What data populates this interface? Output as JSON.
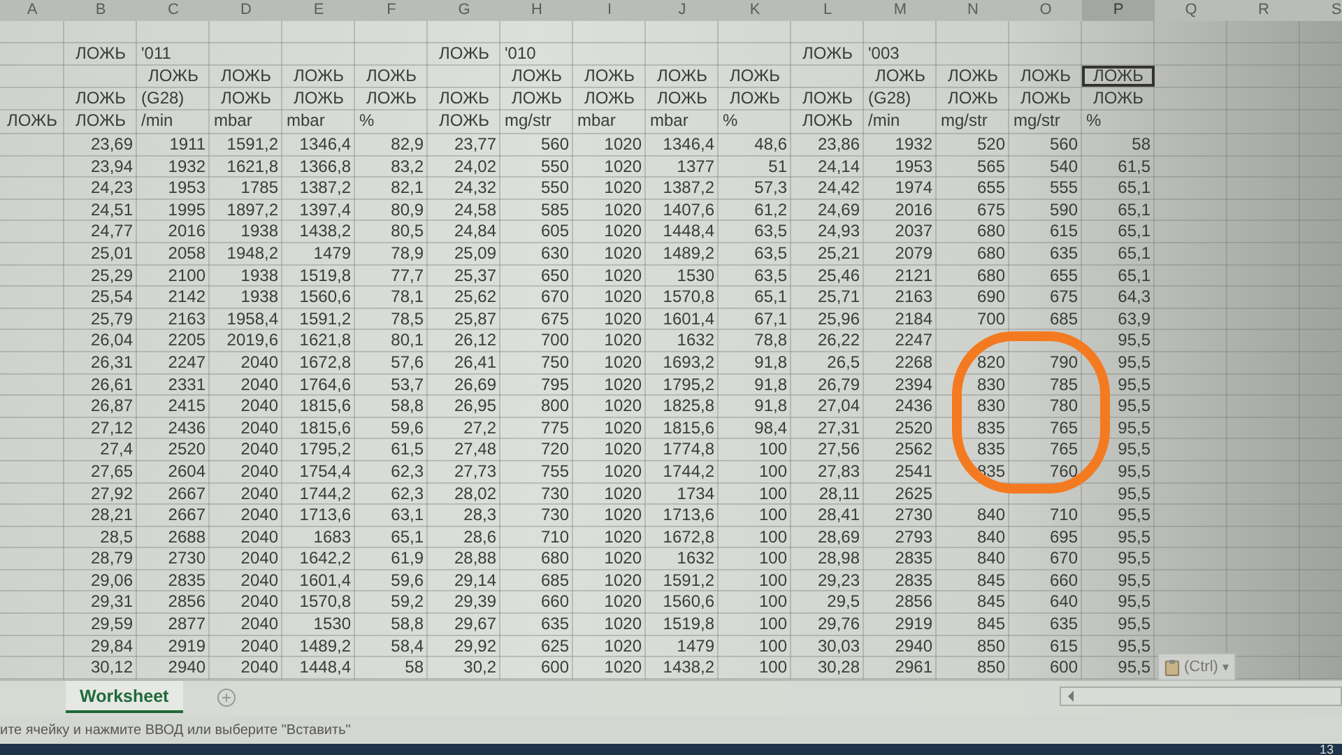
{
  "columns": [
    {
      "label": "A",
      "selected": false
    },
    {
      "label": "B",
      "selected": false
    },
    {
      "label": "C",
      "selected": false
    },
    {
      "label": "D",
      "selected": false
    },
    {
      "label": "E",
      "selected": false
    },
    {
      "label": "F",
      "selected": false
    },
    {
      "label": "G",
      "selected": false
    },
    {
      "label": "H",
      "selected": false
    },
    {
      "label": "I",
      "selected": false
    },
    {
      "label": "J",
      "selected": false
    },
    {
      "label": "K",
      "selected": false
    },
    {
      "label": "L",
      "selected": false
    },
    {
      "label": "M",
      "selected": false
    },
    {
      "label": "N",
      "selected": false
    },
    {
      "label": "O",
      "selected": false
    },
    {
      "label": "P",
      "selected": true
    },
    {
      "label": "Q",
      "selected": false
    },
    {
      "label": "R",
      "selected": false
    },
    {
      "label": "S",
      "selected": false
    }
  ],
  "rows": [
    {
      "selected": false,
      "cells": []
    },
    {
      "selected": false,
      "cells": [
        null,
        {
          "text": "ЛОЖЬ",
          "kind": "bool"
        },
        {
          "text": "'011",
          "kind": "text"
        },
        null,
        null,
        null,
        {
          "text": "ЛОЖЬ",
          "kind": "bool"
        },
        {
          "text": "'010",
          "kind": "text"
        },
        null,
        null,
        null,
        {
          "text": "ЛОЖЬ",
          "kind": "bool"
        },
        {
          "text": "'003",
          "kind": "text"
        }
      ]
    },
    {
      "selected": true,
      "cells": [
        null,
        null,
        {
          "text": "ЛОЖЬ",
          "kind": "bool"
        },
        {
          "text": "ЛОЖЬ",
          "kind": "bool"
        },
        {
          "text": "ЛОЖЬ",
          "kind": "bool"
        },
        {
          "text": "ЛОЖЬ",
          "kind": "bool"
        },
        null,
        {
          "text": "ЛОЖЬ",
          "kind": "bool"
        },
        {
          "text": "ЛОЖЬ",
          "kind": "bool"
        },
        {
          "text": "ЛОЖЬ",
          "kind": "bool"
        },
        {
          "text": "ЛОЖЬ",
          "kind": "bool"
        },
        null,
        {
          "text": "ЛОЖЬ",
          "kind": "bool"
        },
        {
          "text": "ЛОЖЬ",
          "kind": "bool"
        },
        {
          "text": "ЛОЖЬ",
          "kind": "bool"
        },
        {
          "text": "ЛОЖЬ",
          "kind": "bool"
        }
      ]
    },
    {
      "selected": false,
      "cells": [
        null,
        {
          "text": "ЛОЖЬ",
          "kind": "bool"
        },
        {
          "text": "(G28)",
          "kind": "text"
        },
        {
          "text": "ЛОЖЬ",
          "kind": "bool"
        },
        {
          "text": "ЛОЖЬ",
          "kind": "bool"
        },
        {
          "text": "ЛОЖЬ",
          "kind": "bool"
        },
        {
          "text": "ЛОЖЬ",
          "kind": "bool"
        },
        {
          "text": "ЛОЖЬ",
          "kind": "bool"
        },
        {
          "text": "ЛОЖЬ",
          "kind": "bool"
        },
        {
          "text": "ЛОЖЬ",
          "kind": "bool"
        },
        {
          "text": "ЛОЖЬ",
          "kind": "bool"
        },
        {
          "text": "ЛОЖЬ",
          "kind": "bool"
        },
        {
          "text": "(G28)",
          "kind": "text"
        },
        {
          "text": "ЛОЖЬ",
          "kind": "bool"
        },
        {
          "text": "ЛОЖЬ",
          "kind": "bool"
        },
        {
          "text": "ЛОЖЬ",
          "kind": "bool"
        }
      ]
    },
    {
      "selected": false,
      "cells": [
        {
          "text": "ЛОЖЬ",
          "kind": "bool"
        },
        {
          "text": "ЛОЖЬ",
          "kind": "bool"
        },
        {
          "text": "/min",
          "kind": "text"
        },
        {
          "text": "mbar",
          "kind": "text"
        },
        {
          "text": "mbar",
          "kind": "text"
        },
        {
          "text": "%",
          "kind": "text"
        },
        {
          "text": "ЛОЖЬ",
          "kind": "bool"
        },
        {
          "text": "mg/str",
          "kind": "text"
        },
        {
          "text": "mbar",
          "kind": "text"
        },
        {
          "text": "mbar",
          "kind": "text"
        },
        {
          "text": "%",
          "kind": "text"
        },
        {
          "text": "ЛОЖЬ",
          "kind": "bool"
        },
        {
          "text": "/min",
          "kind": "text"
        },
        {
          "text": "mg/str",
          "kind": "text"
        },
        {
          "text": "mg/str",
          "kind": "text"
        },
        {
          "text": "%",
          "kind": "text"
        }
      ]
    },
    {
      "selected": false,
      "cells": [
        null,
        "23,69",
        "1911",
        "1591,2",
        "1346,4",
        "82,9",
        "23,77",
        "560",
        "1020",
        "1346,4",
        "48,6",
        "23,86",
        "1932",
        "520",
        "560",
        "58"
      ]
    },
    {
      "selected": false,
      "cells": [
        null,
        "23,94",
        "1932",
        "1621,8",
        "1366,8",
        "83,2",
        "24,02",
        "550",
        "1020",
        "1377",
        "51",
        "24,14",
        "1953",
        "565",
        "540",
        "61,5"
      ]
    },
    {
      "selected": false,
      "cells": [
        null,
        "24,23",
        "1953",
        "1785",
        "1387,2",
        "82,1",
        "24,32",
        "550",
        "1020",
        "1387,2",
        "57,3",
        "24,42",
        "1974",
        "655",
        "555",
        "65,1"
      ]
    },
    {
      "selected": false,
      "cells": [
        null,
        "24,51",
        "1995",
        "1897,2",
        "1397,4",
        "80,9",
        "24,58",
        "585",
        "1020",
        "1407,6",
        "61,2",
        "24,69",
        "2016",
        "675",
        "590",
        "65,1"
      ]
    },
    {
      "selected": false,
      "cells": [
        null,
        "24,77",
        "2016",
        "1938",
        "1438,2",
        "80,5",
        "24,84",
        "605",
        "1020",
        "1448,4",
        "63,5",
        "24,93",
        "2037",
        "680",
        "615",
        "65,1"
      ]
    },
    {
      "selected": false,
      "cells": [
        null,
        "25,01",
        "2058",
        "1948,2",
        "1479",
        "78,9",
        "25,09",
        "630",
        "1020",
        "1489,2",
        "63,5",
        "25,21",
        "2079",
        "680",
        "635",
        "65,1"
      ]
    },
    {
      "selected": false,
      "cells": [
        null,
        "25,29",
        "2100",
        "1938",
        "1519,8",
        "77,7",
        "25,37",
        "650",
        "1020",
        "1530",
        "63,5",
        "25,46",
        "2121",
        "680",
        "655",
        "65,1"
      ]
    },
    {
      "selected": false,
      "cells": [
        null,
        "25,54",
        "2142",
        "1938",
        "1560,6",
        "78,1",
        "25,62",
        "670",
        "1020",
        "1570,8",
        "65,1",
        "25,71",
        "2163",
        "690",
        "675",
        "64,3"
      ]
    },
    {
      "selected": false,
      "cells": [
        null,
        "25,79",
        "2163",
        "1958,4",
        "1591,2",
        "78,5",
        "25,87",
        "675",
        "1020",
        "1601,4",
        "67,1",
        "25,96",
        "2184",
        "700",
        "685",
        "63,9"
      ]
    },
    {
      "selected": false,
      "cells": [
        null,
        "26,04",
        "2205",
        "2019,6",
        "1621,8",
        "80,1",
        "26,12",
        "700",
        "1020",
        "1632",
        "78,8",
        "26,22",
        "2247",
        null,
        null,
        "95,5"
      ]
    },
    {
      "selected": false,
      "cells": [
        null,
        "26,31",
        "2247",
        "2040",
        "1672,8",
        "57,6",
        "26,41",
        "750",
        "1020",
        "1693,2",
        "91,8",
        "26,5",
        "2268",
        "820",
        "790",
        "95,5"
      ]
    },
    {
      "selected": false,
      "cells": [
        null,
        "26,61",
        "2331",
        "2040",
        "1764,6",
        "53,7",
        "26,69",
        "795",
        "1020",
        "1795,2",
        "91,8",
        "26,79",
        "2394",
        "830",
        "785",
        "95,5"
      ]
    },
    {
      "selected": false,
      "cells": [
        null,
        "26,87",
        "2415",
        "2040",
        "1815,6",
        "58,8",
        "26,95",
        "800",
        "1020",
        "1825,8",
        "91,8",
        "27,04",
        "2436",
        "830",
        "780",
        "95,5"
      ]
    },
    {
      "selected": false,
      "cells": [
        null,
        "27,12",
        "2436",
        "2040",
        "1815,6",
        "59,6",
        "27,2",
        "775",
        "1020",
        "1815,6",
        "98,4",
        "27,31",
        "2520",
        "835",
        "765",
        "95,5"
      ]
    },
    {
      "selected": false,
      "cells": [
        null,
        "27,4",
        "2520",
        "2040",
        "1795,2",
        "61,5",
        "27,48",
        "720",
        "1020",
        "1774,8",
        "100",
        "27,56",
        "2562",
        "835",
        "765",
        "95,5"
      ]
    },
    {
      "selected": false,
      "cells": [
        null,
        "27,65",
        "2604",
        "2040",
        "1754,4",
        "62,3",
        "27,73",
        "755",
        "1020",
        "1744,2",
        "100",
        "27,83",
        "2541",
        "835",
        "760",
        "95,5"
      ]
    },
    {
      "selected": false,
      "cells": [
        null,
        "27,92",
        "2667",
        "2040",
        "1744,2",
        "62,3",
        "28,02",
        "730",
        "1020",
        "1734",
        "100",
        "28,11",
        "2625",
        null,
        null,
        "95,5"
      ]
    },
    {
      "selected": false,
      "cells": [
        null,
        "28,21",
        "2667",
        "2040",
        "1713,6",
        "63,1",
        "28,3",
        "730",
        "1020",
        "1713,6",
        "100",
        "28,41",
        "2730",
        "840",
        "710",
        "95,5"
      ]
    },
    {
      "selected": false,
      "cells": [
        null,
        "28,5",
        "2688",
        "2040",
        "1683",
        "65,1",
        "28,6",
        "710",
        "1020",
        "1672,8",
        "100",
        "28,69",
        "2793",
        "840",
        "695",
        "95,5"
      ]
    },
    {
      "selected": false,
      "cells": [
        null,
        "28,79",
        "2730",
        "2040",
        "1642,2",
        "61,9",
        "28,88",
        "680",
        "1020",
        "1632",
        "100",
        "28,98",
        "2835",
        "840",
        "670",
        "95,5"
      ]
    },
    {
      "selected": false,
      "cells": [
        null,
        "29,06",
        "2835",
        "2040",
        "1601,4",
        "59,6",
        "29,14",
        "685",
        "1020",
        "1591,2",
        "100",
        "29,23",
        "2835",
        "845",
        "660",
        "95,5"
      ]
    },
    {
      "selected": false,
      "cells": [
        null,
        "29,31",
        "2856",
        "2040",
        "1570,8",
        "59,2",
        "29,39",
        "660",
        "1020",
        "1560,6",
        "100",
        "29,5",
        "2856",
        "845",
        "640",
        "95,5"
      ]
    },
    {
      "selected": false,
      "cells": [
        null,
        "29,59",
        "2877",
        "2040",
        "1530",
        "58,8",
        "29,67",
        "635",
        "1020",
        "1519,8",
        "100",
        "29,76",
        "2919",
        "845",
        "635",
        "95,5"
      ]
    },
    {
      "selected": false,
      "cells": [
        null,
        "29,84",
        "2919",
        "2040",
        "1489,2",
        "58,4",
        "29,92",
        "625",
        "1020",
        "1479",
        "100",
        "30,03",
        "2940",
        "850",
        "615",
        "95,5"
      ]
    },
    {
      "selected": false,
      "cells": [
        null,
        "30,12",
        "2940",
        "2040",
        "1448,4",
        "58",
        "30,2",
        "600",
        "1020",
        "1438,2",
        "100",
        "30,28",
        "2961",
        "850",
        "600",
        "95,5"
      ]
    }
  ],
  "annotation": {
    "kind": "ellipse"
  },
  "paste_options": {
    "label": "(Ctrl)",
    "caret": "▾"
  },
  "sheet_tabs": [
    {
      "label": "Worksheet",
      "selected": true
    }
  ],
  "status_bar": {
    "text": "ите ячейку и нажмите ВВОД или выберите \"Вставить\""
  },
  "taskbar": {
    "clock": "13"
  }
}
